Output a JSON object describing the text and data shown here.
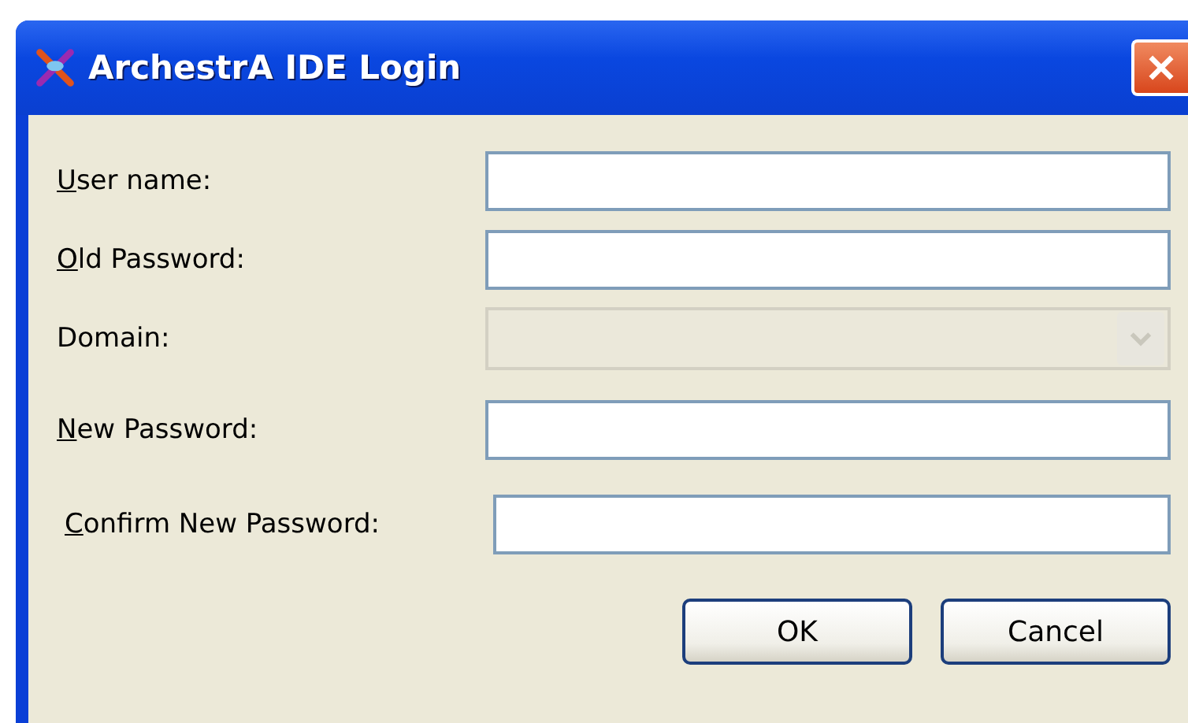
{
  "window": {
    "title": "ArchestrA IDE Login"
  },
  "fields": [
    {
      "kind": "text",
      "label_key": "U",
      "label_rest": "ser name:",
      "disabled": false
    },
    {
      "kind": "text",
      "label_key": "O",
      "label_rest": "ld Password:",
      "disabled": false
    },
    {
      "kind": "combo",
      "label_rest": "Domain:",
      "disabled": true
    },
    {
      "kind": "text",
      "label_key": "N",
      "label_rest": "ew Password:",
      "disabled": false
    },
    {
      "kind": "text",
      "label_key": "C",
      "label_rest": "onfirm New Password:",
      "disabled": false
    }
  ],
  "buttons": [
    "OK",
    "Cancel"
  ]
}
